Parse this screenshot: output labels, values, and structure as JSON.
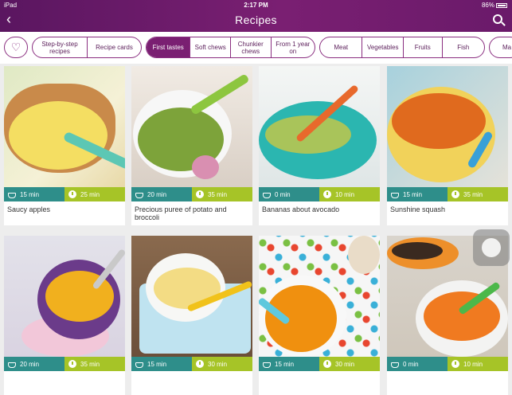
{
  "status": {
    "device": "iPad",
    "time": "2:17 PM",
    "battery": "86%"
  },
  "header": {
    "title": "Recipes"
  },
  "filters": {
    "group1": [
      "Step-by-step recipes",
      "Recipe cards"
    ],
    "group2": [
      "First tastes",
      "Soft chews",
      "Chunkier chews",
      "From 1 year on"
    ],
    "group3": [
      "Meat",
      "Vegetables",
      "Fruits",
      "Fish",
      "Ma"
    ],
    "active": "First tastes"
  },
  "recipes": [
    {
      "name": "Saucy apples",
      "prep": "15 min",
      "cook": "25 min"
    },
    {
      "name": "Precious puree of potato and broccoli",
      "prep": "20 min",
      "cook": "35 min"
    },
    {
      "name": "Bananas about avocado",
      "prep": "0 min",
      "cook": "10 min"
    },
    {
      "name": "Sunshine squash",
      "prep": "15 min",
      "cook": "35 min"
    },
    {
      "name": "",
      "prep": "20 min",
      "cook": "35 min"
    },
    {
      "name": "",
      "prep": "15 min",
      "cook": "30 min"
    },
    {
      "name": "",
      "prep": "15 min",
      "cook": "30 min"
    },
    {
      "name": "",
      "prep": "0 min",
      "cook": "10 min"
    }
  ]
}
